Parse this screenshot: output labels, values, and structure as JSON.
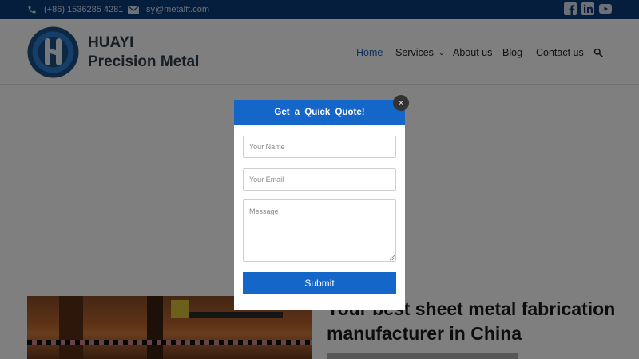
{
  "topbar": {
    "phone": "(+86) 1536285 4281",
    "email": "sy@metalft.com",
    "social_icons": [
      "facebook-icon",
      "linkedin-icon",
      "youtube-icon"
    ]
  },
  "header": {
    "logo_line1": "HUAYI",
    "logo_line2": "Precision Metal",
    "nav": {
      "home": "Home",
      "services": "Services",
      "about": "About us",
      "blog": "Blog",
      "contact": "Contact us"
    }
  },
  "hero": {
    "title_line1": "Your best sheet metal fabrication",
    "title_line2": "manufacturer in China"
  },
  "modal": {
    "title": "Get a Quick Quote!",
    "close_label": "×",
    "name_placeholder": "Your Name",
    "email_placeholder": "Your Email",
    "message_placeholder": "Message",
    "submit_label": "Submit"
  },
  "colors": {
    "topbar": "#0a3d7a",
    "accent": "#1466c8",
    "nav_active": "#1f63b5"
  }
}
